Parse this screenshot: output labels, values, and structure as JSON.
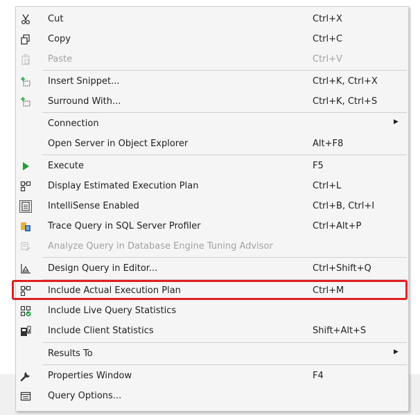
{
  "menu": {
    "items": [
      {
        "label": "Cut",
        "shortcut": "Ctrl+X",
        "icon": "scissors-icon"
      },
      {
        "label": "Copy",
        "shortcut": "Ctrl+C",
        "icon": "copy-icon"
      },
      {
        "label": "Paste",
        "shortcut": "Ctrl+V",
        "icon": "paste-icon",
        "disabled": true
      },
      {
        "label": "Insert Snippet...",
        "shortcut": "Ctrl+K, Ctrl+X",
        "icon": "snippet-icon"
      },
      {
        "label": "Surround With...",
        "shortcut": "Ctrl+K, Ctrl+S",
        "icon": "surround-icon"
      },
      {
        "label": "Connection",
        "shortcut": "",
        "icon": "",
        "submenu": true
      },
      {
        "label": "Open Server in Object Explorer",
        "shortcut": "Alt+F8",
        "icon": ""
      },
      {
        "label": "Execute",
        "shortcut": "F5",
        "icon": "play-icon"
      },
      {
        "label": "Display Estimated Execution Plan",
        "shortcut": "Ctrl+L",
        "icon": "execution-plan-icon"
      },
      {
        "label": "IntelliSense Enabled",
        "shortcut": "Ctrl+B, Ctrl+I",
        "icon": "intellisense-icon"
      },
      {
        "label": "Trace Query in SQL Server Profiler",
        "shortcut": "Ctrl+Alt+P",
        "icon": "profiler-icon"
      },
      {
        "label": "Analyze Query in Database Engine Tuning Advisor",
        "shortcut": "",
        "icon": "tuning-advisor-icon",
        "disabled": true
      },
      {
        "label": "Design Query in Editor...",
        "shortcut": "Ctrl+Shift+Q",
        "icon": "design-query-icon"
      },
      {
        "label": "Include Actual Execution Plan",
        "shortcut": "Ctrl+M",
        "icon": "actual-plan-icon",
        "highlighted": true
      },
      {
        "label": "Include Live Query Statistics",
        "shortcut": "",
        "icon": "live-stats-icon"
      },
      {
        "label": "Include Client Statistics",
        "shortcut": "Shift+Alt+S",
        "icon": "client-stats-icon"
      },
      {
        "label": "Results To",
        "shortcut": "",
        "icon": "",
        "submenu": true
      },
      {
        "label": "Properties Window",
        "shortcut": "F4",
        "icon": "wrench-icon"
      },
      {
        "label": "Query Options...",
        "shortcut": "",
        "icon": "query-options-icon"
      }
    ]
  },
  "colors": {
    "highlight_border": "#e02020",
    "execute_green": "#1e9e3a",
    "disabled_text": "#a2a2a2"
  }
}
